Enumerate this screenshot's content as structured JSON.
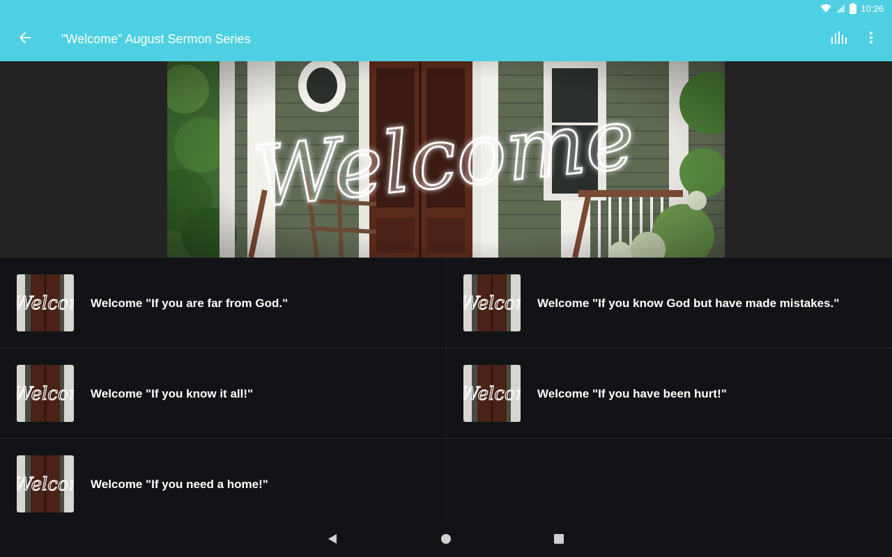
{
  "status_bar": {
    "time": "10:26",
    "icons": [
      "wifi-icon",
      "signal-icon",
      "battery-icon"
    ]
  },
  "app_bar": {
    "title": "\"Welcome\" August Sermon Series",
    "back_icon": "arrow-back-icon",
    "actions": [
      "equalizer-icon",
      "more-vert-icon"
    ],
    "color": "#4fd0e2"
  },
  "hero": {
    "script_text": "Welcome"
  },
  "sermons": [
    {
      "title": "Welcome \"If you are far from God.\"",
      "thumb_text": "Welcom"
    },
    {
      "title": "Welcome \"If you know God but have made mistakes.\"",
      "thumb_text": "Welcom"
    },
    {
      "title": "Welcome \"If you know it all!\"",
      "thumb_text": "Welcom"
    },
    {
      "title": "Welcome \"If you have been hurt!\"",
      "thumb_text": "Welcom"
    },
    {
      "title": "Welcome \"If you need a home!\"",
      "thumb_text": "Welcom"
    }
  ],
  "nav_bar": {
    "icons": [
      "nav-back-icon",
      "nav-home-icon",
      "nav-recents-icon"
    ]
  }
}
